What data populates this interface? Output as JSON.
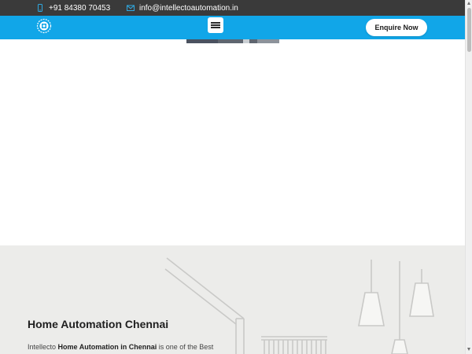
{
  "topbar": {
    "phone": {
      "icon": "phone-icon",
      "text": "+91 84380 70453"
    },
    "email": {
      "icon": "mail-icon",
      "text": "info@intellectoautomation.in"
    }
  },
  "header": {
    "logo_icon": "company-logo",
    "menu_icon": "hamburger-menu-icon",
    "enquire_label": "Enquire Now"
  },
  "about": {
    "title": "Home Automation Chennai",
    "text_prefix": "Intellecto ",
    "text_bold": "Home Automation in Chennai",
    "text_suffix": " is one of the Best"
  },
  "colors": {
    "topbar_bg": "#3a3a3a",
    "header_bg": "#11a6e8",
    "accent_icon": "#2fa8e0",
    "section_bg": "#ececea"
  }
}
